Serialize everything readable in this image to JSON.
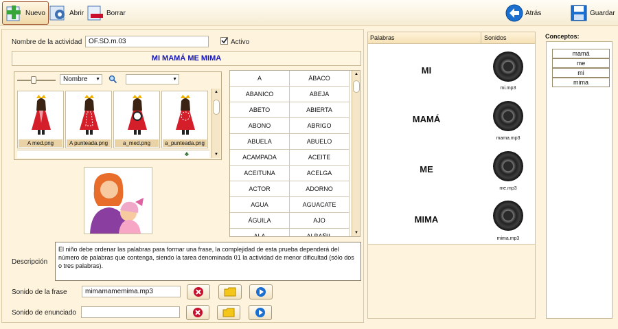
{
  "toolbar": {
    "nuevo": "Nuevo",
    "abrir": "Abrir",
    "borrar": "Borrar",
    "atras": "Atrás",
    "guardar": "Guardar"
  },
  "form": {
    "nombre_label": "Nombre de la actividad",
    "nombre_value": "OF.SD.m.03",
    "activo_label": "Activo",
    "activo_checked": true,
    "title": "MI MAMÁ ME MIMA",
    "descripcion_label": "Descripción",
    "descripcion_text": "El niño debe ordenar las palabras para formar una frase, la complejidad de esta prueba dependerá del número de palabras que contenga, siendo la tarea denominada 01 la actividad de menor dificultad (sólo dos o tres palabras).",
    "sonido_frase_label": "Sonido de la frase",
    "sonido_frase_value": "mimamamemima.mp3",
    "sonido_enunciado_label": "Sonido de enunciado",
    "sonido_enunciado_value": ""
  },
  "browser": {
    "sort_value": "Nombre",
    "filter_value": "",
    "thumbs": [
      {
        "caption": "A med.png"
      },
      {
        "caption": "A punteada.png"
      },
      {
        "caption": "a_med.png"
      },
      {
        "caption": "a_punteada.png"
      }
    ]
  },
  "words": [
    "A",
    "ÁBACO",
    "ABANICO",
    "ABEJA",
    "ABETO",
    "ABIERTA",
    "ABONO",
    "ABRIGO",
    "ABUELA",
    "ABUELO",
    "ACAMPADA",
    "ACEITE",
    "ACEITUNA",
    "ACELGA",
    "ACTOR",
    "ADORNO",
    "AGUA",
    "AGUACATE",
    "ÁGUILA",
    "AJO",
    "ALA",
    "ALBAÑIL"
  ],
  "palabras": {
    "col_palabras": "Palabras",
    "col_sonidos": "Sonidos",
    "rows": [
      {
        "word": "MI",
        "sound": "mi.mp3"
      },
      {
        "word": "MAMÁ",
        "sound": "mama.mp3"
      },
      {
        "word": "ME",
        "sound": "me.mp3"
      },
      {
        "word": "MIMA",
        "sound": "mima.mp3"
      }
    ]
  },
  "conceptos": {
    "title": "Conceptos:",
    "items": [
      "mamá",
      "me",
      "mi",
      "mima"
    ]
  },
  "colors": {
    "background": "#fef3dc",
    "title_text": "#1515b8",
    "accent_blue": "#1a6fd0",
    "delete_red": "#c8102e"
  }
}
